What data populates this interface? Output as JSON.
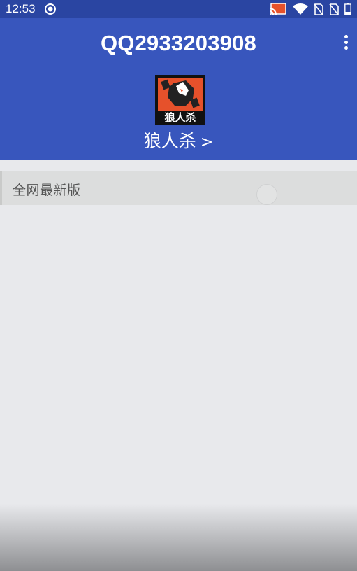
{
  "status_bar": {
    "time": "12:53",
    "icons": [
      "record-icon",
      "cast-icon",
      "wifi-icon",
      "no-sim-icon",
      "no-sim-icon",
      "battery-icon"
    ]
  },
  "app_bar": {
    "title": "QQ2933203908",
    "menu_icon": "more-vert-icon",
    "game_name": "狼人杀",
    "game_arrow": ">",
    "game_icon_text": "狼人杀",
    "background": "#3856bd"
  },
  "list": {
    "items": [
      {
        "label": "全网最新版"
      }
    ]
  },
  "colors": {
    "status_bar": "#2a45a2",
    "app_bar": "#3856bd",
    "background": "#e8e9ec",
    "icon_accent": "#e6512b"
  }
}
